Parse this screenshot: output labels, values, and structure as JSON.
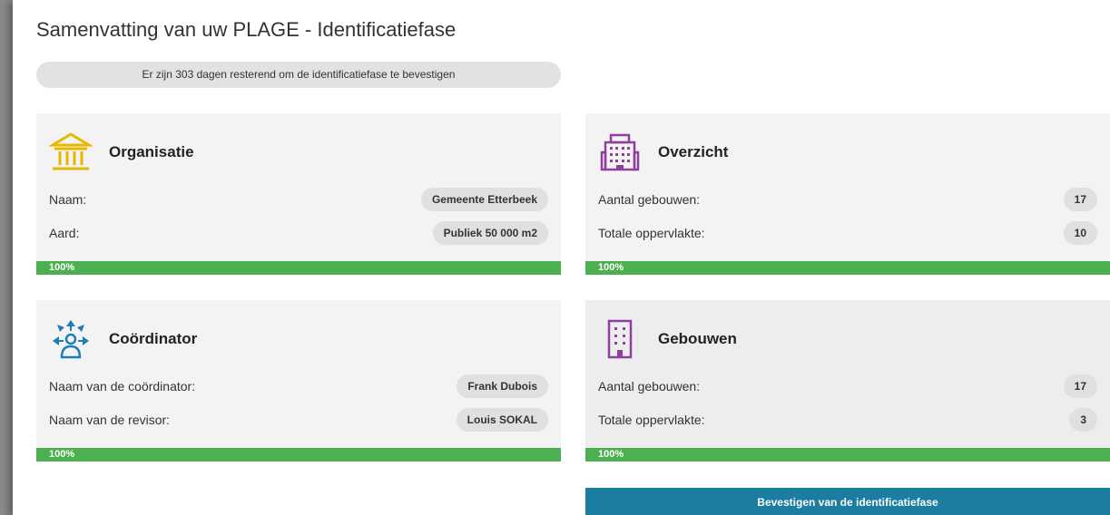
{
  "page": {
    "title": "Samenvatting van uw PLAGE - Identificatiefase",
    "days_remaining": "Er zijn 303 dagen resterend om de identificatiefase te bevestigen"
  },
  "cards": {
    "organisatie": {
      "title": "Organisatie",
      "icon": "institution-icon",
      "icon_color": "#e6b800",
      "rows": [
        {
          "label": "Naam:",
          "value": "Gemeente Etterbeek"
        },
        {
          "label": "Aard:",
          "value": "Publiek 50 000 m2"
        }
      ],
      "progress": 1.0,
      "progress_label": "100%"
    },
    "overzicht": {
      "title": "Overzicht",
      "icon": "office-building-icon",
      "icon_color": "#8e3fa0",
      "rows": [
        {
          "label": "Aantal gebouwen:",
          "value": "17"
        },
        {
          "label": "Totale oppervlakte:",
          "value": "10"
        }
      ],
      "progress": 1.0,
      "progress_label": "100%"
    },
    "coordinator": {
      "title": "Coördinator",
      "icon": "coordinator-network-icon",
      "icon_color": "#1e7fb5",
      "rows": [
        {
          "label": "Naam van de coördinator:",
          "value": "Frank Dubois"
        },
        {
          "label": "Naam van de revisor:",
          "value": "Louis SOKAL"
        }
      ],
      "progress": 1.0,
      "progress_label": "100%"
    },
    "gebouwen": {
      "title": "Gebouwen",
      "icon": "building-icon",
      "icon_color": "#8e3fa0",
      "rows": [
        {
          "label": "Aantal gebouwen:",
          "value": "17"
        },
        {
          "label": "Totale oppervlakte:",
          "value": "3"
        }
      ],
      "progress": 1.0,
      "progress_label": "100%"
    }
  },
  "actions": {
    "confirm_label": "Bevestigen van de identificatiefase"
  },
  "colors": {
    "progress": "#4caf50",
    "button": "#1b7ea0",
    "card_bg": "#f3f3f3"
  }
}
